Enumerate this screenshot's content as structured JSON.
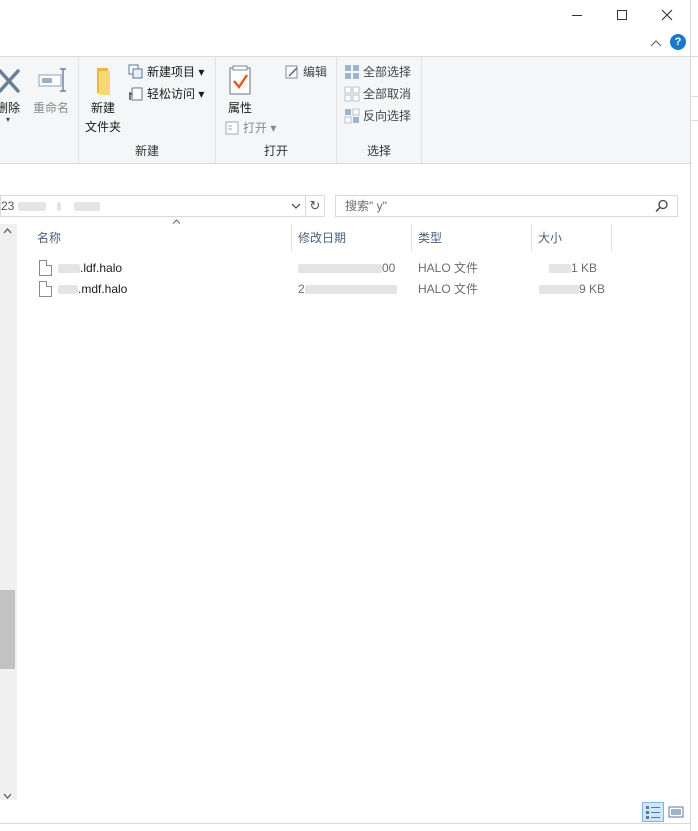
{
  "window": {
    "minimize_label": "—",
    "maximize_label": "☐",
    "close_label": "✕"
  },
  "ribbon": {
    "groups": {
      "organize_partial": {
        "delete_label": "删除",
        "rename_label": "重命名"
      },
      "new": {
        "label": "新建",
        "new_folder_label_1": "新建",
        "new_folder_label_2": "文件夹",
        "new_item_label": "新建项目 ▾",
        "easy_access_label": "轻松访问 ▾"
      },
      "open": {
        "label": "打开",
        "properties_label": "属性",
        "edit_label": "编辑",
        "open_label": "打开 ▾"
      },
      "select": {
        "label": "选择",
        "select_all_label": "全部选择",
        "select_none_label": "全部取消",
        "invert_label": "反向选择"
      }
    }
  },
  "address": {
    "path_text": "23",
    "dropdown_glyph": "⌄",
    "refresh_glyph": "↻"
  },
  "search": {
    "placeholder": "搜索\"       y\""
  },
  "columns": {
    "name": "名称",
    "date": "修改日期",
    "type": "类型",
    "size": "大小"
  },
  "files": [
    {
      "name": ".ldf.halo",
      "date": "00",
      "type": "HALO 文件",
      "size": "1 KB"
    },
    {
      "name": ".mdf.halo",
      "date": "2",
      "type": "HALO 文件",
      "size": "9 KB"
    }
  ],
  "colors": {
    "ribbon_bg": "#f5f6f7",
    "header_text": "#4c607a",
    "help_blue": "#1979ca",
    "active_view": "#cce8ff"
  }
}
